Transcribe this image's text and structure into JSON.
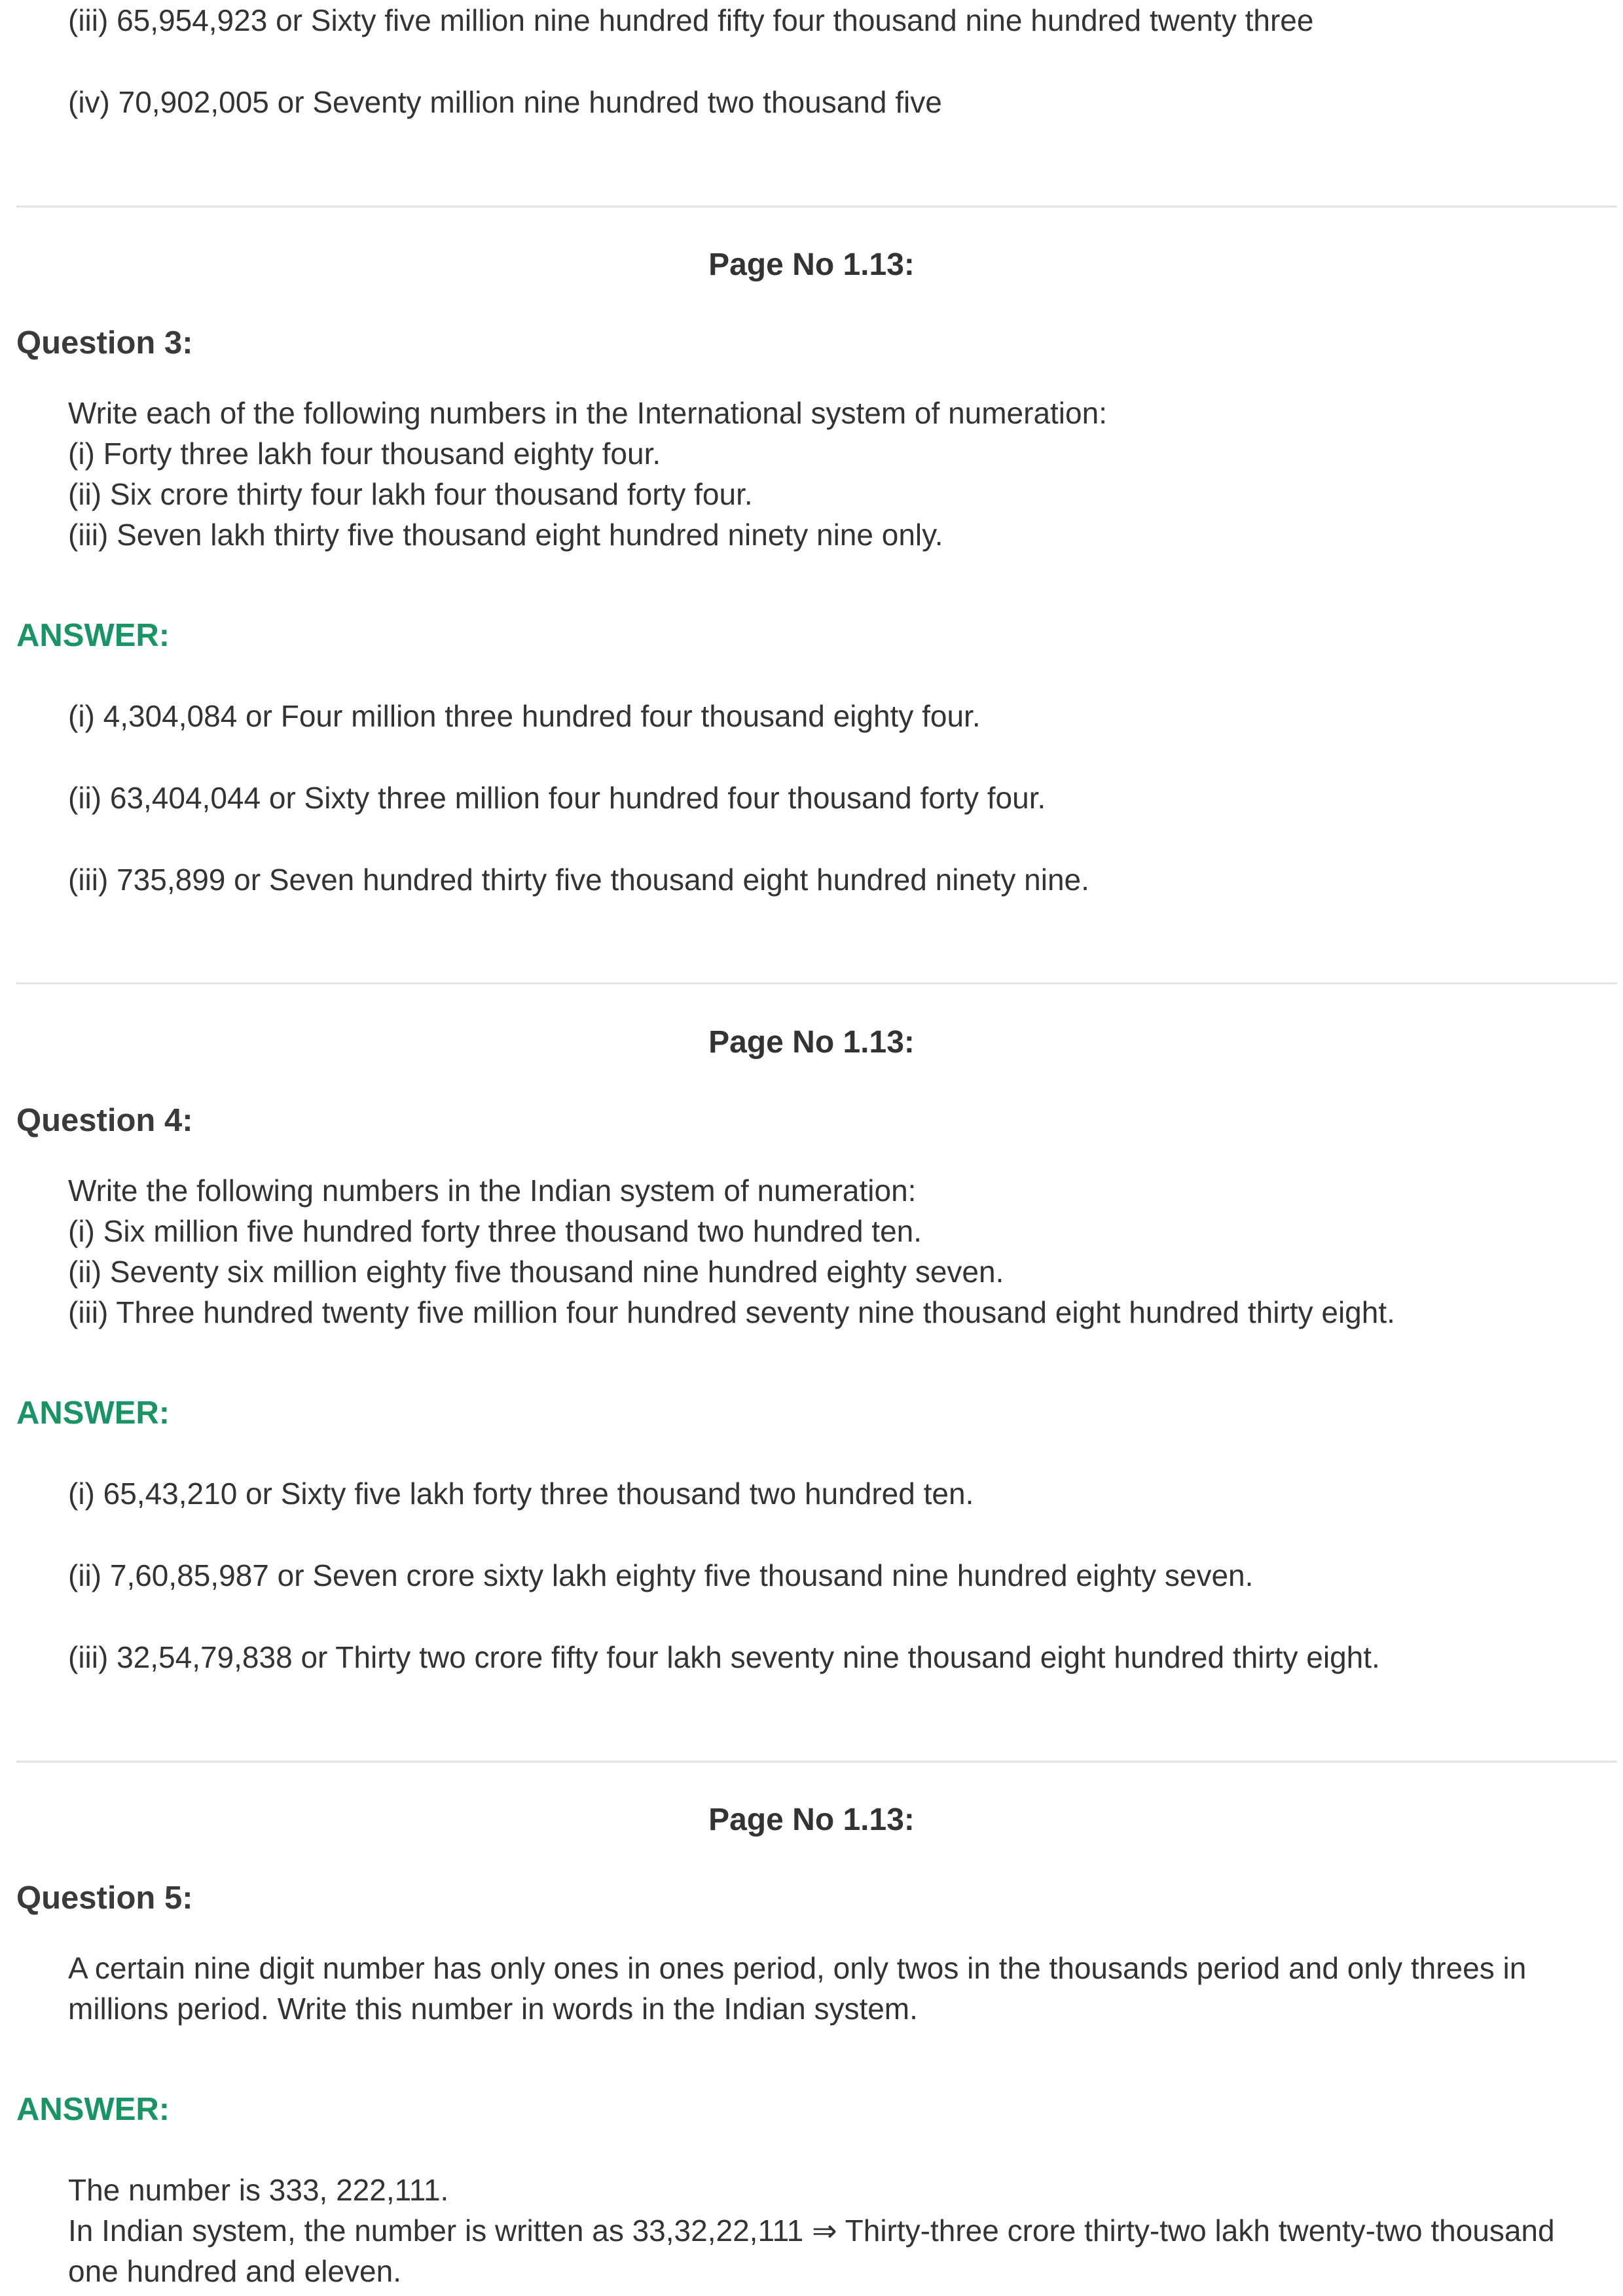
{
  "top_answers": [
    "(iii) 65,954,923 or Sixty five million nine hundred fifty four thousand nine hundred twenty three",
    "(iv) 70,902,005 or Seventy million nine hundred two thousand five"
  ],
  "sections": [
    {
      "page_no": "Page No 1.13:",
      "question_label": "Question 3:",
      "question_lines": [
        "Write each of the following numbers in the International system of numeration:",
        "(i) Forty three lakh four thousand eighty four.",
        "(ii) Six crore thirty four lakh four thousand forty four.",
        "(iii) Seven lakh thirty five thousand eight hundred ninety nine only."
      ],
      "answer_label": "ANSWER:",
      "answer_lines": [
        "(i) 4,304,084 or Four million three hundred four thousand eighty four.",
        "(ii) 63,404,044 or Sixty three million four hundred four thousand forty four.",
        "(iii) 735,899 or Seven hundred thirty five thousand eight hundred ninety nine."
      ]
    },
    {
      "page_no": "Page No 1.13:",
      "question_label": "Question 4:",
      "question_lines": [
        "Write the following numbers in the Indian system of numeration:",
        "(i) Six million five hundred forty three thousand two hundred ten.",
        "(ii) Seventy six million eighty five thousand nine hundred eighty seven.",
        "(iii) Three hundred twenty five million four hundred seventy nine thousand eight hundred thirty eight."
      ],
      "answer_label": "ANSWER:",
      "answer_lines": [
        "(i) 65,43,210 or Sixty five lakh forty three thousand two hundred ten.",
        "(ii) 7,60,85,987 or Seven crore sixty lakh eighty five thousand nine hundred eighty seven.",
        "(iii) 32,54,79,838 or Thirty two crore fifty four lakh seventy nine thousand eight hundred thirty eight."
      ]
    },
    {
      "page_no": "Page No 1.13:",
      "question_label": "Question 5:",
      "question_lines": [
        "A certain nine digit number has only ones in ones period, only twos in the thousands period and only threes in",
        "millions period. Write this number in words in the Indian system."
      ],
      "answer_label": "ANSWER:",
      "answer_lines": [
        "The number is 333, 222,111.",
        "In Indian system, the number is written as 33,32,22,111 ⇒ Thirty-three crore thirty-two lakh twenty-two thousand",
        "one hundred and eleven."
      ]
    }
  ]
}
